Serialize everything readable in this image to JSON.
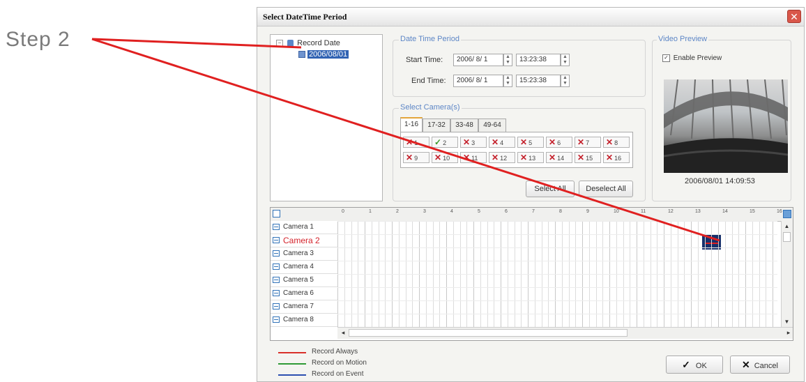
{
  "annotation": {
    "step_label": "Step 2",
    "arrow_color": "#e02020"
  },
  "dialog": {
    "title": "Select DateTime Period",
    "close_glyph": "✕"
  },
  "tree": {
    "root": "Record Date",
    "child": "2006/08/01"
  },
  "date_time_period": {
    "title": "Date Time Period",
    "start_label": "Start Time:",
    "start_date": "2006/ 8/ 1",
    "start_time": "13:23:38",
    "end_label": "End Time:",
    "end_date": "2006/ 8/ 1",
    "end_time": "15:23:38"
  },
  "select_cameras": {
    "title": "Select Camera(s)",
    "tabs": [
      "1-16",
      "17-32",
      "33-48",
      "49-64"
    ],
    "cameras": [
      {
        "label": "1",
        "checked": false
      },
      {
        "label": "2",
        "checked": true
      },
      {
        "label": "3",
        "checked": false
      },
      {
        "label": "4",
        "checked": false
      },
      {
        "label": "5",
        "checked": false
      },
      {
        "label": "6",
        "checked": false
      },
      {
        "label": "7",
        "checked": false
      },
      {
        "label": "8",
        "checked": false
      },
      {
        "label": "9",
        "checked": false
      },
      {
        "label": "10",
        "checked": false
      },
      {
        "label": "11",
        "checked": false
      },
      {
        "label": "12",
        "checked": false
      },
      {
        "label": "13",
        "checked": false
      },
      {
        "label": "14",
        "checked": false
      },
      {
        "label": "15",
        "checked": false
      },
      {
        "label": "16",
        "checked": false
      }
    ],
    "select_all": "Select All",
    "deselect_all": "Deselect All"
  },
  "video_preview": {
    "title": "Video Preview",
    "enable_label": "Enable Preview",
    "enabled": true,
    "timestamp": "2006/08/01 14:09:53"
  },
  "timeline": {
    "ticks": [
      "0",
      "1",
      "2",
      "3",
      "4",
      "5",
      "6",
      "7",
      "8",
      "9",
      "10",
      "11",
      "12",
      "13",
      "14",
      "15",
      "16"
    ],
    "cameras": [
      "Camera 1",
      "Camera 2",
      "Camera 3",
      "Camera 4",
      "Camera 5",
      "Camera 6",
      "Camera 7",
      "Camera 8"
    ],
    "highlight_camera_index": 1,
    "highlight_color": "#d4232b",
    "selection": {
      "camera_index": 1,
      "start_hour": 13.4,
      "end_hour": 14.1,
      "color": "#17306b"
    }
  },
  "legend": [
    {
      "label": "Record Always",
      "color": "#d9302a"
    },
    {
      "label": "Record on Motion",
      "color": "#2f9a36"
    },
    {
      "label": "Record on Event",
      "color": "#2b4fb0"
    }
  ],
  "buttons": {
    "ok": "OK",
    "cancel": "Cancel"
  }
}
